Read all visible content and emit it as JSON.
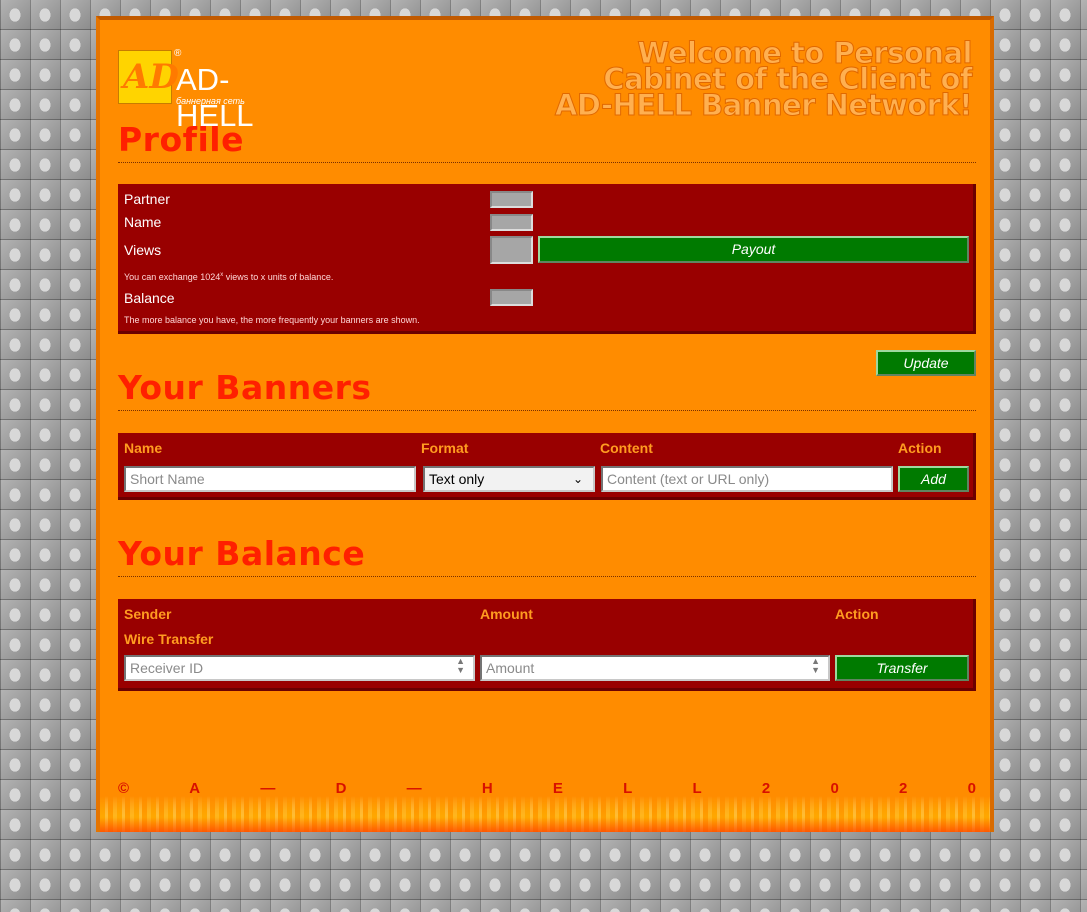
{
  "logo": {
    "glyph": "AD",
    "reg": "®",
    "name": "AD-HELL",
    "subtitle": "баннерная сеть"
  },
  "welcome": {
    "line1": "Welcome to Personal",
    "line2": "Cabinet of the Client of",
    "line3": "AD-HELL Banner Network!"
  },
  "profile": {
    "title": "Profile",
    "partner_label": "Partner",
    "name_label": "Name",
    "views_label": "Views",
    "payout_button": "Payout",
    "exchange_note_pre": "You can exchange 1024",
    "exchange_note_sup": "x",
    "exchange_note_post": " views to x units of balance.",
    "balance_label": "Balance",
    "balance_note": "The more balance you have, the more frequently your banners are shown.",
    "update_button": "Update"
  },
  "banners": {
    "title": "Your Banners",
    "col_name": "Name",
    "col_format": "Format",
    "col_content": "Content",
    "col_action": "Action",
    "name_placeholder": "Short Name",
    "format_selected": "Text only",
    "content_placeholder": "Content (text or URL only)",
    "add_button": "Add"
  },
  "balance": {
    "title": "Your Balance",
    "col_sender": "Sender",
    "col_amount": "Amount",
    "col_action": "Action",
    "row_label": "Wire Transfer",
    "receiver_placeholder": "Receiver ID",
    "amount_placeholder": "Amount",
    "transfer_button": "Transfer"
  },
  "footer": {
    "chars": [
      "©",
      "A",
      "—",
      "D",
      "—",
      "H",
      "E",
      "L",
      "L",
      "2",
      "0",
      "2",
      "0"
    ]
  },
  "colors": {
    "page": "#ff8c00",
    "panel": "#990000",
    "title": "#ff2000",
    "header": "#ff9c20",
    "button": "#007a00"
  }
}
